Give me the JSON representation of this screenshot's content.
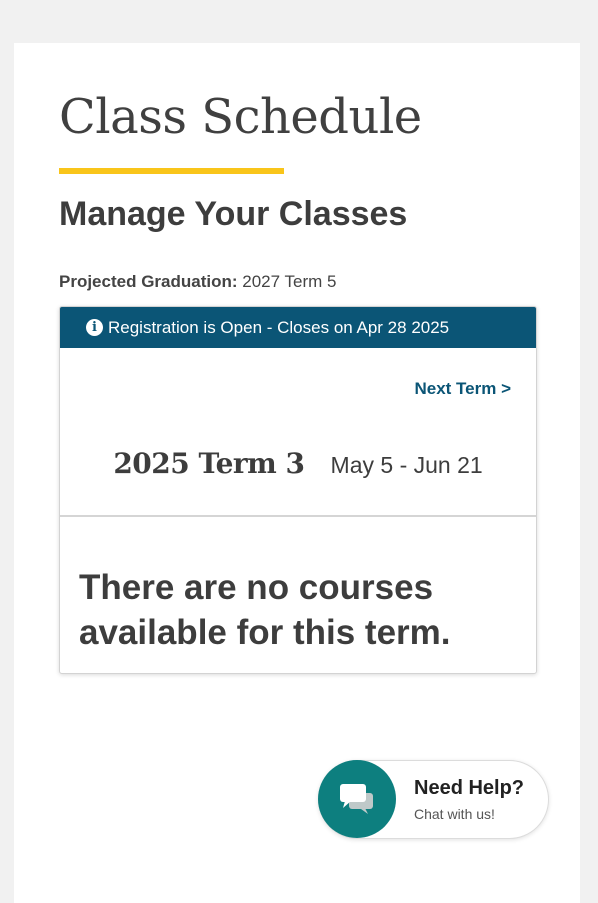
{
  "page": {
    "title": "Class Schedule",
    "subtitle": "Manage Your Classes",
    "graduation_label": "Projected Graduation:",
    "graduation_value": "2027 Term 5"
  },
  "term_card": {
    "banner_text": "Registration is Open - Closes on Apr 28 2025",
    "banner_icon": "info-icon",
    "next_term_label": "Next Term >",
    "term_name": "2025 Term 3",
    "term_dates": "May 5 - Jun 21",
    "empty_message": "There are no courses available for this term."
  },
  "help_widget": {
    "title": "Need Help?",
    "subtitle": "Chat with us!",
    "icon": "chat-bubbles-icon"
  },
  "colors": {
    "accent_yellow": "#f9c51a",
    "banner_blue": "#0b5576",
    "help_teal": "#0d7f7f"
  }
}
